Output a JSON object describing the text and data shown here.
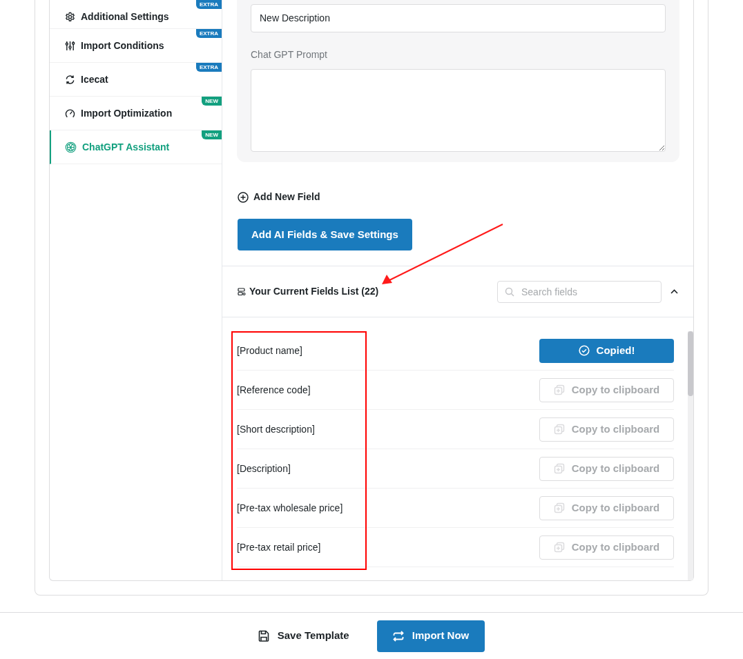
{
  "sidebar": {
    "items": [
      {
        "label": "Additional Settings",
        "badge": {
          "text": "EXTRA",
          "kind": "extra"
        },
        "selected": false
      },
      {
        "label": "Import Conditions",
        "badge": {
          "text": "EXTRA",
          "kind": "extra"
        },
        "selected": false
      },
      {
        "label": "Icecat",
        "badge": {
          "text": "EXTRA",
          "kind": "extra"
        },
        "selected": false
      },
      {
        "label": "Import Optimization",
        "badge": {
          "text": "NEW",
          "kind": "new"
        },
        "selected": false
      },
      {
        "label": "ChatGPT Assistant",
        "badge": {
          "text": "NEW",
          "kind": "new"
        },
        "selected": true
      }
    ]
  },
  "ai_field": {
    "name_value": "New Description",
    "prompt_label": "Chat GPT Prompt"
  },
  "add_field": "Add New Field",
  "save_button": "Add AI Fields & Save Settings",
  "fields_list": {
    "title": "Your Current Fields List (22)",
    "search": {
      "placeholder": "Search fields"
    },
    "expanded": true,
    "rows": [
      {
        "label": "[Product name]",
        "button": "Copied!",
        "copied": true
      },
      {
        "label": "[Reference code]",
        "button": "Copy to clipboard",
        "copied": false
      },
      {
        "label": "[Short description]",
        "button": "Copy to clipboard",
        "copied": false
      },
      {
        "label": "[Description]",
        "button": "Copy to clipboard",
        "copied": false
      },
      {
        "label": "[Pre-tax wholesale price]",
        "button": "Copy to clipboard",
        "copied": false
      },
      {
        "label": "[Pre-tax retail price]",
        "button": "Copy to clipboard",
        "copied": false
      }
    ]
  },
  "footer": {
    "save_template": "Save Template",
    "import_now": "Import Now"
  }
}
